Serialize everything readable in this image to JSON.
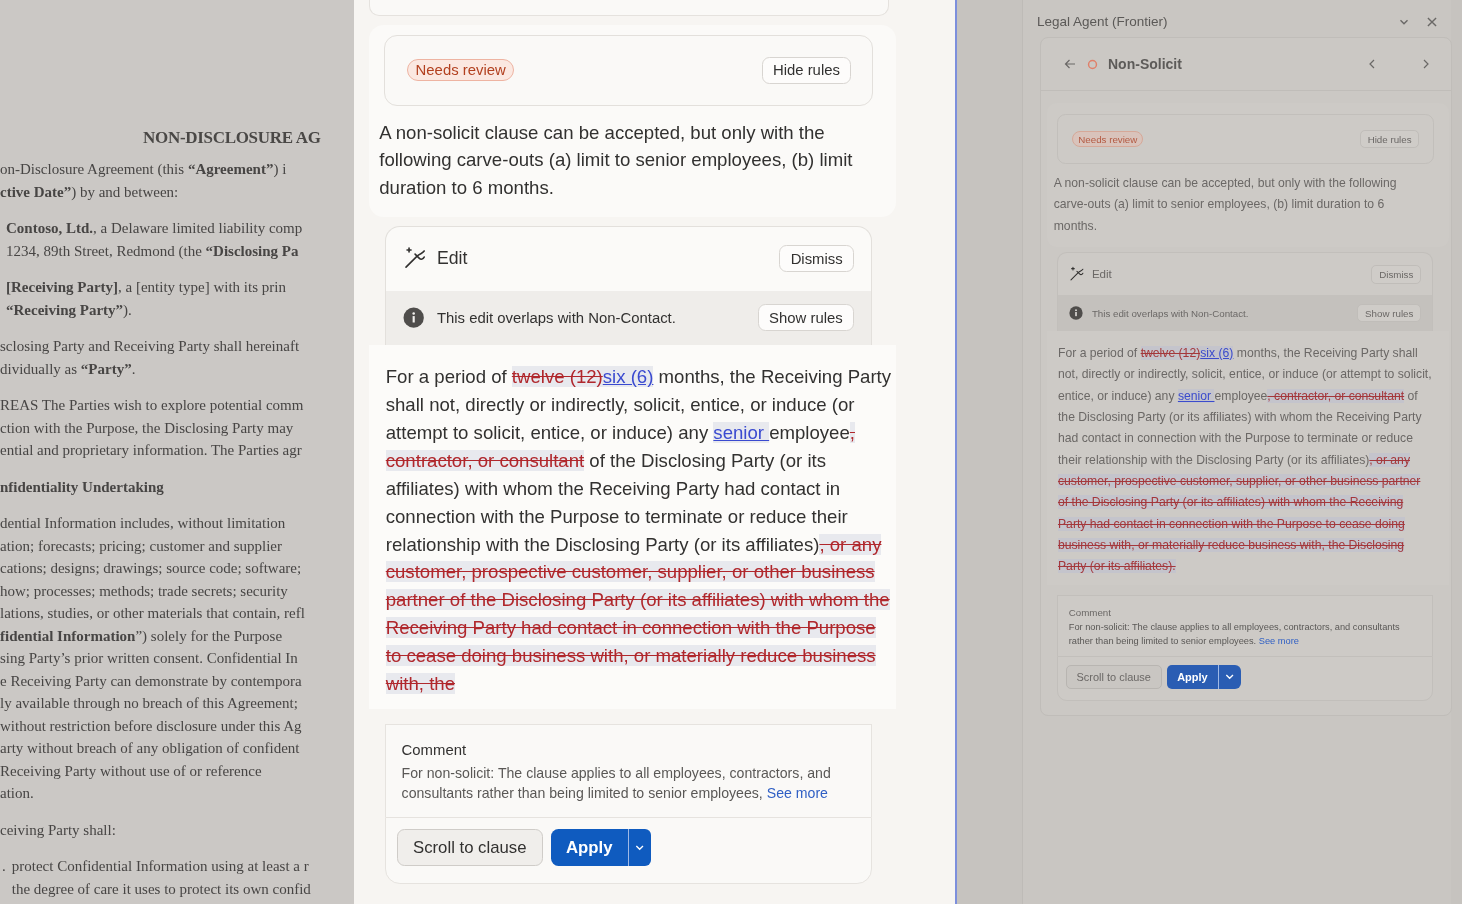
{
  "document": {
    "title": "NON-DISCLOSURE AG",
    "blocks": [
      {
        "kind": "para",
        "lines": [
          "on-Disclosure Agreement (this **“Agreement”**) i",
          "**ctive Date”**) by and between:"
        ]
      },
      {
        "kind": "indent",
        "lines": [
          "**Contoso, Ltd.**, a Delaware limited liability comp",
          "1234, 89th Street, Redmond (the **“Disclosing Pa**"
        ]
      },
      {
        "kind": "indent",
        "lines": [
          "**[Receiving Party]**, a [entity type] with its prin",
          "**“Receiving Party”**)."
        ]
      },
      {
        "kind": "para",
        "lines": [
          "sclosing Party and Receiving Party shall hereinaft",
          "dividually as **“Party”**."
        ]
      },
      {
        "kind": "para",
        "lines": [
          "REAS The Parties wish to explore potential comm",
          "ction with the Purpose, the Disclosing Party may",
          "ential and proprietary information. The Parties agr"
        ]
      },
      {
        "kind": "heading",
        "lines": [
          "nfidentiality Undertaking"
        ]
      },
      {
        "kind": "para",
        "lines": [
          "dential Information includes, without limitation",
          "ation; forecasts; pricing; customer and supplier",
          "cations; designs; drawings; source code; software;",
          "how; processes; methods; trade secrets; security",
          "lations, studies, or other materials that contain, refl",
          "**fidential Information**”) solely for the Purpose",
          "sing Party’s prior written consent. Confidential In",
          "e Receiving Party can demonstrate by contempora",
          "ly available through no breach of this Agreement;",
          "without restriction before disclosure under this Ag",
          "arty without breach of any obligation of confident",
          "Receiving Party without use of or reference",
          "ation."
        ]
      },
      {
        "kind": "para",
        "lines": [
          "ceiving Party shall:"
        ]
      },
      {
        "kind": "list",
        "marker": ".",
        "lines": [
          "protect Confidential Information using at least a r",
          "the degree of care it uses to protect its own confid"
        ]
      }
    ]
  },
  "magnifier": {
    "status_badge": "Needs review",
    "hide_rules": "Hide rules",
    "rule_text": "A non-solicit clause can be accepted, but only with the following carve-outs (a) limit to senior employees, (b) limit duration to 6 months.",
    "edit": {
      "title": "Edit",
      "dismiss": "Dismiss",
      "overlap_notice": "This edit overlaps with Non-Contact.",
      "show_rules": "Show rules"
    },
    "redline": [
      {
        "kind": "text",
        "text": "For a period of "
      },
      {
        "kind": "deleted",
        "text": "twelve (12)"
      },
      {
        "kind": "inserted",
        "text": "six (6)"
      },
      {
        "kind": "text",
        "text": " months, the Receiving Party shall not, directly or indirectly, solicit, entice, or induce (or attempt to solicit, entice, or induce) any "
      },
      {
        "kind": "inserted",
        "text": "senior "
      },
      {
        "kind": "text",
        "text": "employee"
      },
      {
        "kind": "deleted",
        "text": ", contractor, or consultant"
      },
      {
        "kind": "text",
        "text": " of the Disclosing Party (or its affiliates) with whom the Receiving Party had contact in connection with the Purpose to terminate or reduce their relationship with the Disclosing Party (or its affiliates)"
      },
      {
        "kind": "deleted",
        "text": ", or any customer, prospective customer, supplier, or other business partner of the Disclosing Party (or its affiliates) with whom the Receiving Party had contact in connection with the Purpose to cease doing business with, or materially reduce business with, the"
      }
    ],
    "comment": {
      "label": "Comment",
      "text": "For non-solicit: The clause applies to all employees, contractors, and consultants rather than being limited to senior employees,",
      "link": "See more"
    },
    "actions": {
      "secondary": "Scroll to clause",
      "primary": "Apply"
    }
  },
  "side_panel": {
    "title": "Legal Agent (Frontier)",
    "clause_title": "Non-Solicit",
    "status_badge": "Needs review",
    "hide_rules": "Hide rules",
    "rule_text": "A non-solicit clause can be accepted, but only with the following carve-outs (a) limit to senior employees, (b) limit duration to 6 months.",
    "edit": {
      "title": "Edit",
      "dismiss": "Dismiss",
      "overlap_notice": "This edit overlaps with Non-Contact.",
      "show_rules": "Show rules"
    },
    "redline": [
      {
        "kind": "text",
        "text": "For a period of "
      },
      {
        "kind": "deleted",
        "text": "twelve (12)"
      },
      {
        "kind": "inserted",
        "text": "six (6)"
      },
      {
        "kind": "text",
        "text": " months, the Receiving Party shall not, directly or indirectly, solicit, entice, or induce (or attempt to solicit, entice, or induce) any "
      },
      {
        "kind": "inserted",
        "text": "senior "
      },
      {
        "kind": "text",
        "text": "employee"
      },
      {
        "kind": "deleted",
        "text": ", contractor, or consultant"
      },
      {
        "kind": "text",
        "text": " of the Disclosing Party (or its affiliates) with whom the Receiving Party had contact in connection with the Purpose to terminate or reduce their relationship with the Disclosing Party (or its affiliates)"
      },
      {
        "kind": "deleted",
        "text": ", or any customer, prospective customer, supplier, or other business partner of the Disclosing Party (or its affiliates) with whom the Receiving Party had contact in connection with the Purpose to cease doing business with, or materially reduce business with, the Disclosing Party (or its affiliates)."
      }
    ],
    "comment": {
      "label": "Comment",
      "text": "For non-solicit: The clause applies to all employees, contractors, and consultants rather than being limited to senior employees.",
      "link": "See more"
    },
    "actions": {
      "secondary": "Scroll to clause",
      "primary": "Apply"
    }
  }
}
